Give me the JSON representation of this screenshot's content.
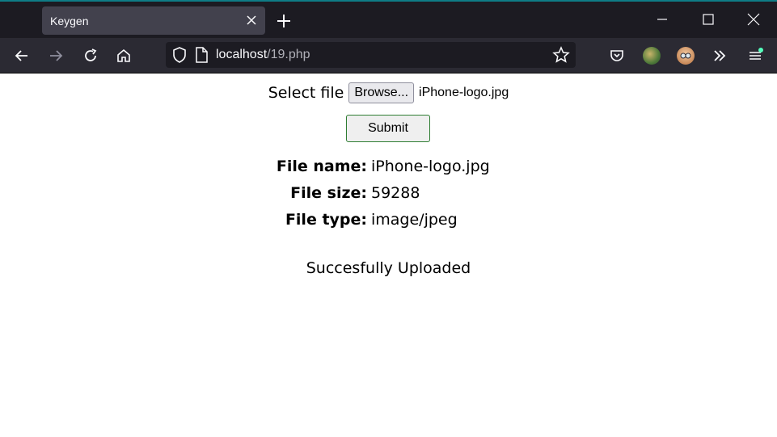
{
  "tab": {
    "title": "Keygen"
  },
  "url": {
    "host": "localhost",
    "path": "/19.php"
  },
  "form": {
    "select_label": "Select file",
    "browse_label": "Browse...",
    "chosen_file": "iPhone-logo.jpg",
    "submit_label": "Submit"
  },
  "file_info": [
    {
      "label": "File name:",
      "value": "iPhone-logo.jpg"
    },
    {
      "label": "File size:",
      "value": "59288"
    },
    {
      "label": "File type:",
      "value": "image/jpeg"
    }
  ],
  "status_message": "Succesfully Uploaded",
  "icons": {
    "tab_close": "close-icon",
    "new_tab": "plus-icon",
    "back": "arrow-left-icon",
    "forward": "arrow-right-icon",
    "reload": "reload-icon",
    "home": "home-icon",
    "shield": "shield-icon",
    "page": "page-icon",
    "bookmark": "star-icon",
    "pocket": "pocket-icon",
    "extensions": "chevron-double-right-icon",
    "menu": "hamburger-menu-icon"
  },
  "colors": {
    "accent": "#0e7c86",
    "submit_border": "#2e7d32"
  }
}
